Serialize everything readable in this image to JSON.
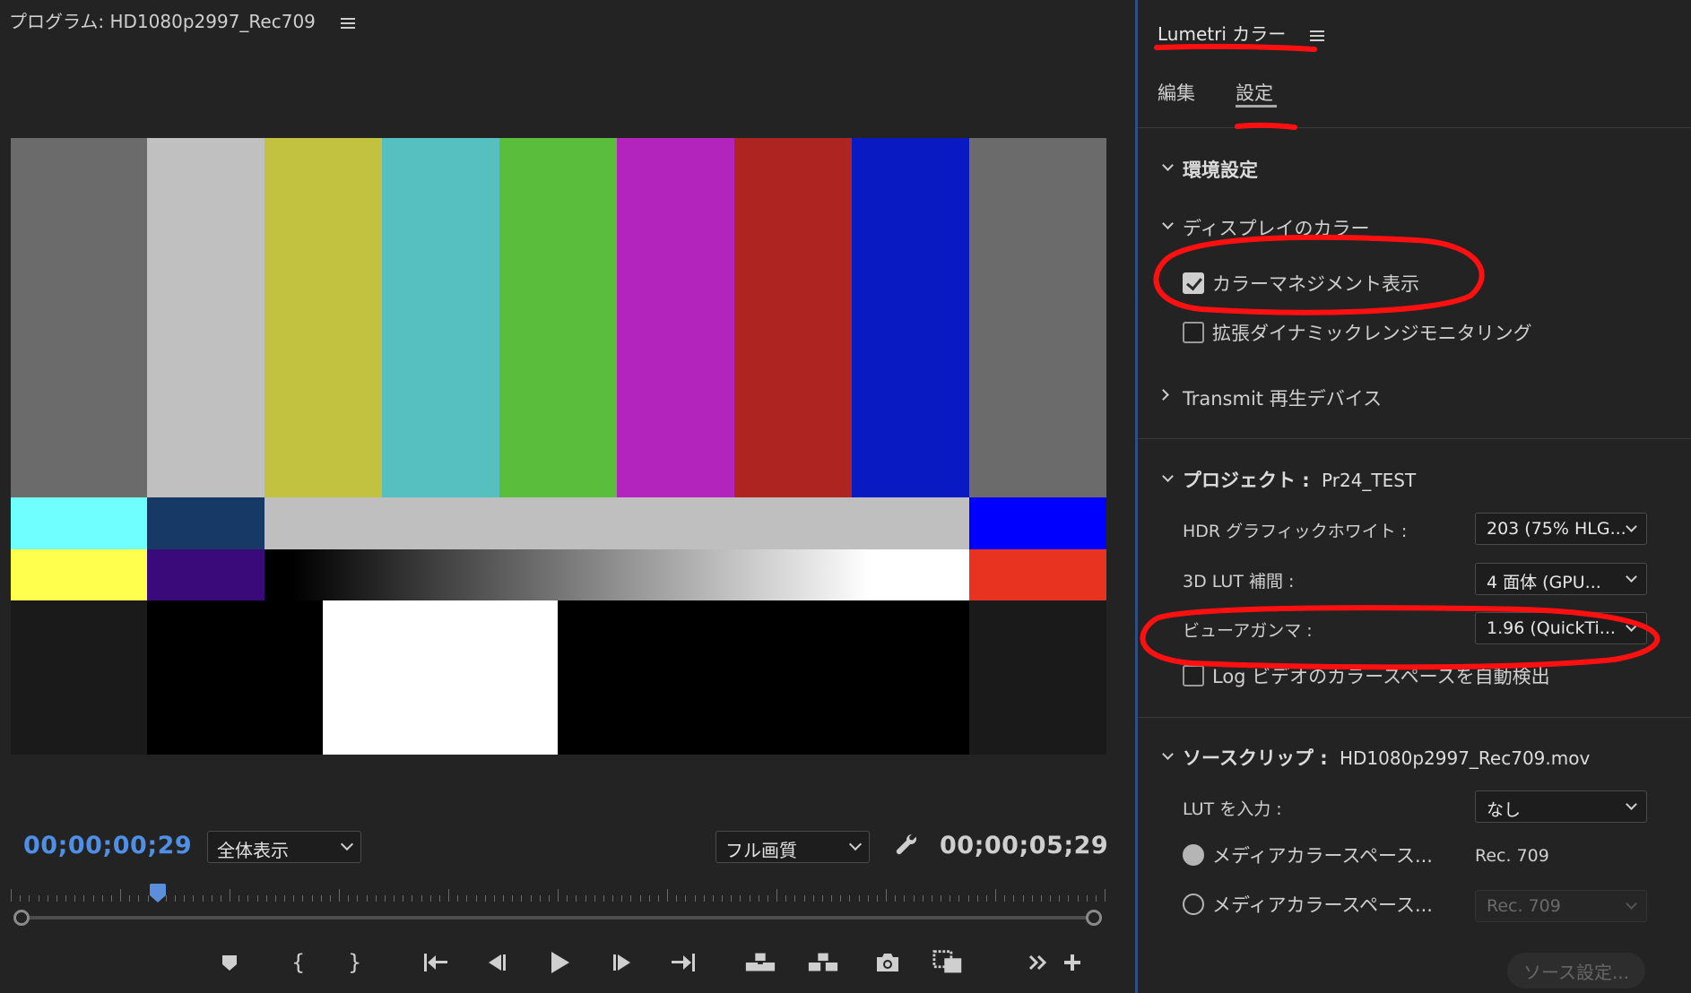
{
  "program_monitor": {
    "title": "プログラム: HD1080p2997_Rec709",
    "current_timecode": "00;00;00;29",
    "duration_timecode": "00;00;05;29",
    "fit_dropdown": "全体表示",
    "quality_dropdown": "フル画質",
    "playhead_fraction": 0.134,
    "color_bars": {
      "top_row": [
        "#6b6b6b",
        "#c0c0c0",
        "#c2c240",
        "#56c0c0",
        "#5abe3c",
        "#b324bd",
        "#ae2420",
        "#0a1ac2",
        "#6b6b6b"
      ],
      "mid_row_left": [
        "#6fffff",
        "#163966"
      ],
      "mid_row_center": "#bfbfbf",
      "mid_row_right": "#0000ff",
      "low_row_left": [
        "#ffff4d",
        "#3a0a7a"
      ],
      "low_row_right": "#e83320",
      "bottom_row": [
        "#1a1a1a",
        "#000000",
        "#ffffff",
        "#000000",
        "#1a1a1a"
      ]
    }
  },
  "lumetri": {
    "title": "Lumetri カラー",
    "tabs": [
      {
        "label": "編集",
        "active": false
      },
      {
        "label": "設定",
        "active": true
      }
    ],
    "preferences": {
      "heading": "環境設定",
      "display_color": {
        "heading": "ディスプレイのカラー",
        "color_management_display": {
          "label": "カラーマネジメント表示",
          "checked": true
        },
        "extended_dynamic_range": {
          "label": "拡張ダイナミックレンジモニタリング",
          "checked": false
        }
      },
      "transmit": "Transmit 再生デバイス"
    },
    "project": {
      "heading": "プロジェクト :",
      "name": "Pr24_TEST",
      "hdr_graphics_white": {
        "label": "HDR グラフィックホワイト :",
        "value": "203 (75% HLG..."
      },
      "lut_interpolation": {
        "label": "3D LUT 補間 :",
        "value": "4 面体 (GPU..."
      },
      "viewer_gamma": {
        "label": "ビューアガンマ :",
        "value": "1.96 (QuickTi..."
      },
      "auto_detect_log": {
        "label": "Log ビデオのカラースペースを自動検出",
        "checked": false
      }
    },
    "source_clip": {
      "heading": "ソースクリップ :",
      "name": "HD1080p2997_Rec709.mov",
      "input_lut": {
        "label": "LUT を入力 :",
        "value": "なし"
      },
      "media_colorspace_1": {
        "label": "メディアカラースペース...",
        "value": "Rec. 709"
      },
      "media_colorspace_2": {
        "label": "メディアカラースペース...",
        "value": "Rec. 709"
      },
      "settings_button": "ソース設定..."
    }
  },
  "colors": {
    "accent_blue": "#4f8fe6",
    "annotation_red": "#ff1010",
    "panel_bg": "#232323"
  }
}
